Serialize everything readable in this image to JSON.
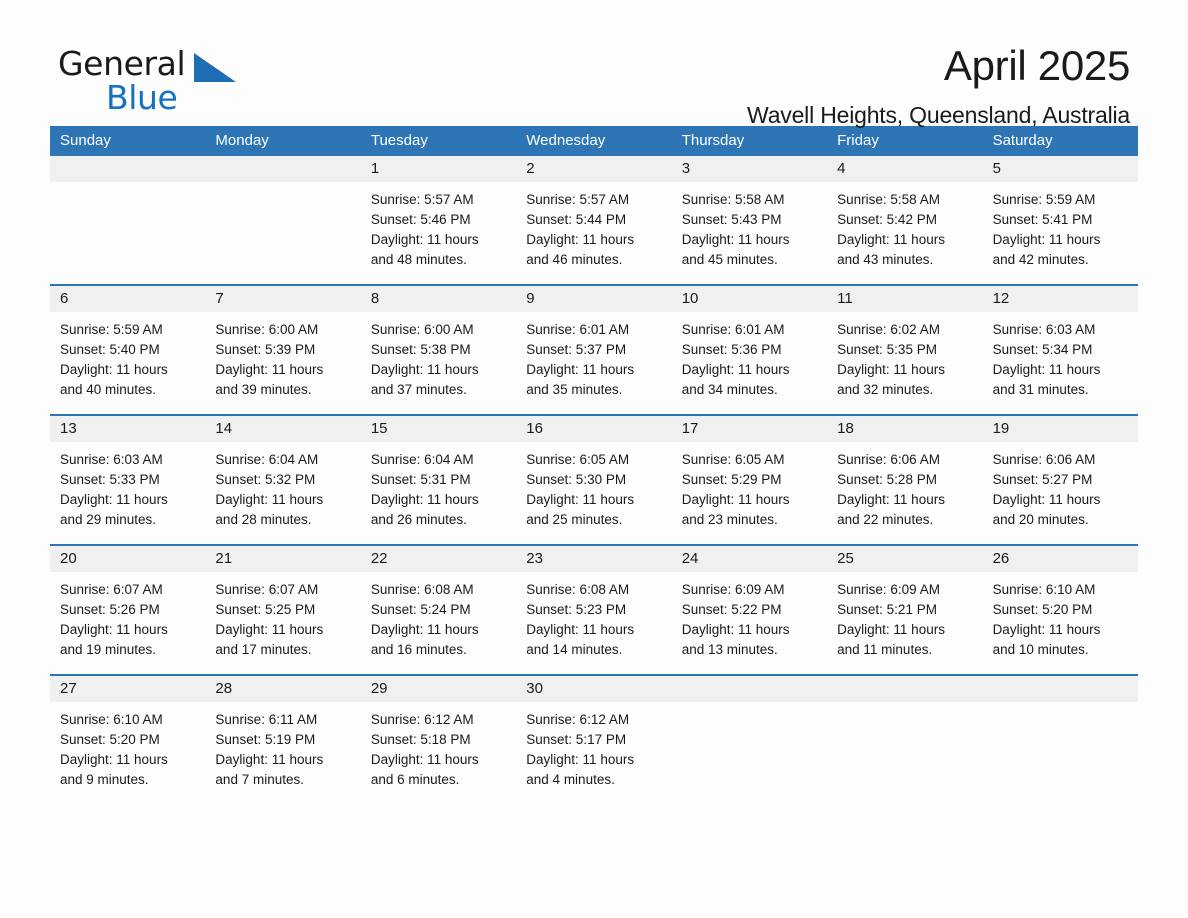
{
  "brand": {
    "name_part1": "General",
    "name_part2": "Blue",
    "accent_color": "#1572c0",
    "header_color": "#2e75b6"
  },
  "header": {
    "title": "April 2025",
    "subtitle": "Wavell Heights, Queensland, Australia"
  },
  "calendar": {
    "day_headers": [
      "Sunday",
      "Monday",
      "Tuesday",
      "Wednesday",
      "Thursday",
      "Friday",
      "Saturday"
    ],
    "weeks": [
      [
        {
          "date": "",
          "empty": true
        },
        {
          "date": "",
          "empty": true
        },
        {
          "date": "1",
          "sunrise": "Sunrise: 5:57 AM",
          "sunset": "Sunset: 5:46 PM",
          "daylight_line1": "Daylight: 11 hours",
          "daylight_line2": "and 48 minutes."
        },
        {
          "date": "2",
          "sunrise": "Sunrise: 5:57 AM",
          "sunset": "Sunset: 5:44 PM",
          "daylight_line1": "Daylight: 11 hours",
          "daylight_line2": "and 46 minutes."
        },
        {
          "date": "3",
          "sunrise": "Sunrise: 5:58 AM",
          "sunset": "Sunset: 5:43 PM",
          "daylight_line1": "Daylight: 11 hours",
          "daylight_line2": "and 45 minutes."
        },
        {
          "date": "4",
          "sunrise": "Sunrise: 5:58 AM",
          "sunset": "Sunset: 5:42 PM",
          "daylight_line1": "Daylight: 11 hours",
          "daylight_line2": "and 43 minutes."
        },
        {
          "date": "5",
          "sunrise": "Sunrise: 5:59 AM",
          "sunset": "Sunset: 5:41 PM",
          "daylight_line1": "Daylight: 11 hours",
          "daylight_line2": "and 42 minutes."
        }
      ],
      [
        {
          "date": "6",
          "sunrise": "Sunrise: 5:59 AM",
          "sunset": "Sunset: 5:40 PM",
          "daylight_line1": "Daylight: 11 hours",
          "daylight_line2": "and 40 minutes."
        },
        {
          "date": "7",
          "sunrise": "Sunrise: 6:00 AM",
          "sunset": "Sunset: 5:39 PM",
          "daylight_line1": "Daylight: 11 hours",
          "daylight_line2": "and 39 minutes."
        },
        {
          "date": "8",
          "sunrise": "Sunrise: 6:00 AM",
          "sunset": "Sunset: 5:38 PM",
          "daylight_line1": "Daylight: 11 hours",
          "daylight_line2": "and 37 minutes."
        },
        {
          "date": "9",
          "sunrise": "Sunrise: 6:01 AM",
          "sunset": "Sunset: 5:37 PM",
          "daylight_line1": "Daylight: 11 hours",
          "daylight_line2": "and 35 minutes."
        },
        {
          "date": "10",
          "sunrise": "Sunrise: 6:01 AM",
          "sunset": "Sunset: 5:36 PM",
          "daylight_line1": "Daylight: 11 hours",
          "daylight_line2": "and 34 minutes."
        },
        {
          "date": "11",
          "sunrise": "Sunrise: 6:02 AM",
          "sunset": "Sunset: 5:35 PM",
          "daylight_line1": "Daylight: 11 hours",
          "daylight_line2": "and 32 minutes."
        },
        {
          "date": "12",
          "sunrise": "Sunrise: 6:03 AM",
          "sunset": "Sunset: 5:34 PM",
          "daylight_line1": "Daylight: 11 hours",
          "daylight_line2": "and 31 minutes."
        }
      ],
      [
        {
          "date": "13",
          "sunrise": "Sunrise: 6:03 AM",
          "sunset": "Sunset: 5:33 PM",
          "daylight_line1": "Daylight: 11 hours",
          "daylight_line2": "and 29 minutes."
        },
        {
          "date": "14",
          "sunrise": "Sunrise: 6:04 AM",
          "sunset": "Sunset: 5:32 PM",
          "daylight_line1": "Daylight: 11 hours",
          "daylight_line2": "and 28 minutes."
        },
        {
          "date": "15",
          "sunrise": "Sunrise: 6:04 AM",
          "sunset": "Sunset: 5:31 PM",
          "daylight_line1": "Daylight: 11 hours",
          "daylight_line2": "and 26 minutes."
        },
        {
          "date": "16",
          "sunrise": "Sunrise: 6:05 AM",
          "sunset": "Sunset: 5:30 PM",
          "daylight_line1": "Daylight: 11 hours",
          "daylight_line2": "and 25 minutes."
        },
        {
          "date": "17",
          "sunrise": "Sunrise: 6:05 AM",
          "sunset": "Sunset: 5:29 PM",
          "daylight_line1": "Daylight: 11 hours",
          "daylight_line2": "and 23 minutes."
        },
        {
          "date": "18",
          "sunrise": "Sunrise: 6:06 AM",
          "sunset": "Sunset: 5:28 PM",
          "daylight_line1": "Daylight: 11 hours",
          "daylight_line2": "and 22 minutes."
        },
        {
          "date": "19",
          "sunrise": "Sunrise: 6:06 AM",
          "sunset": "Sunset: 5:27 PM",
          "daylight_line1": "Daylight: 11 hours",
          "daylight_line2": "and 20 minutes."
        }
      ],
      [
        {
          "date": "20",
          "sunrise": "Sunrise: 6:07 AM",
          "sunset": "Sunset: 5:26 PM",
          "daylight_line1": "Daylight: 11 hours",
          "daylight_line2": "and 19 minutes."
        },
        {
          "date": "21",
          "sunrise": "Sunrise: 6:07 AM",
          "sunset": "Sunset: 5:25 PM",
          "daylight_line1": "Daylight: 11 hours",
          "daylight_line2": "and 17 minutes."
        },
        {
          "date": "22",
          "sunrise": "Sunrise: 6:08 AM",
          "sunset": "Sunset: 5:24 PM",
          "daylight_line1": "Daylight: 11 hours",
          "daylight_line2": "and 16 minutes."
        },
        {
          "date": "23",
          "sunrise": "Sunrise: 6:08 AM",
          "sunset": "Sunset: 5:23 PM",
          "daylight_line1": "Daylight: 11 hours",
          "daylight_line2": "and 14 minutes."
        },
        {
          "date": "24",
          "sunrise": "Sunrise: 6:09 AM",
          "sunset": "Sunset: 5:22 PM",
          "daylight_line1": "Daylight: 11 hours",
          "daylight_line2": "and 13 minutes."
        },
        {
          "date": "25",
          "sunrise": "Sunrise: 6:09 AM",
          "sunset": "Sunset: 5:21 PM",
          "daylight_line1": "Daylight: 11 hours",
          "daylight_line2": "and 11 minutes."
        },
        {
          "date": "26",
          "sunrise": "Sunrise: 6:10 AM",
          "sunset": "Sunset: 5:20 PM",
          "daylight_line1": "Daylight: 11 hours",
          "daylight_line2": "and 10 minutes."
        }
      ],
      [
        {
          "date": "27",
          "sunrise": "Sunrise: 6:10 AM",
          "sunset": "Sunset: 5:20 PM",
          "daylight_line1": "Daylight: 11 hours",
          "daylight_line2": "and 9 minutes."
        },
        {
          "date": "28",
          "sunrise": "Sunrise: 6:11 AM",
          "sunset": "Sunset: 5:19 PM",
          "daylight_line1": "Daylight: 11 hours",
          "daylight_line2": "and 7 minutes."
        },
        {
          "date": "29",
          "sunrise": "Sunrise: 6:12 AM",
          "sunset": "Sunset: 5:18 PM",
          "daylight_line1": "Daylight: 11 hours",
          "daylight_line2": "and 6 minutes."
        },
        {
          "date": "30",
          "sunrise": "Sunrise: 6:12 AM",
          "sunset": "Sunset: 5:17 PM",
          "daylight_line1": "Daylight: 11 hours",
          "daylight_line2": "and 4 minutes."
        },
        {
          "date": "",
          "empty": true
        },
        {
          "date": "",
          "empty": true
        },
        {
          "date": "",
          "empty": true
        }
      ]
    ]
  }
}
